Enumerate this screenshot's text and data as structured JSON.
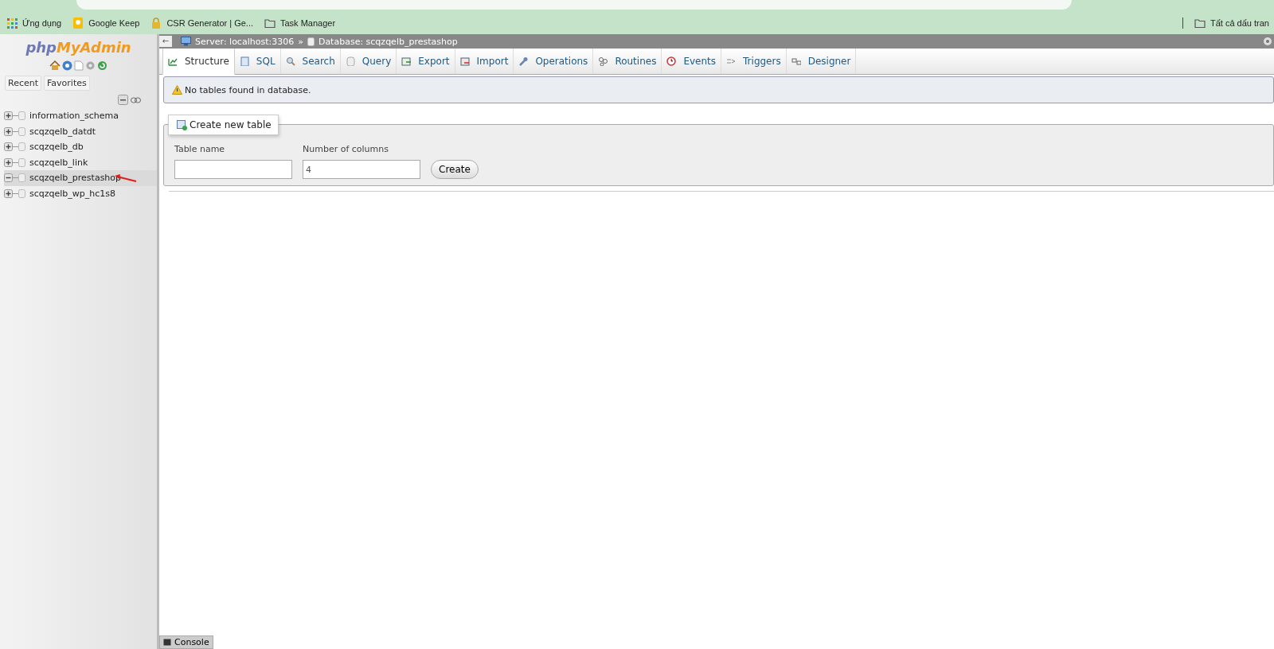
{
  "bookmarks_bar": {
    "items": [
      {
        "label": "Ứng dụng",
        "kind": "apps"
      },
      {
        "label": "Google Keep",
        "kind": "keep"
      },
      {
        "label": "CSR Generator | Ge...",
        "kind": "lock"
      },
      {
        "label": "Task Manager",
        "kind": "folder"
      }
    ],
    "right_item": {
      "label": "Tất cả dấu tran",
      "kind": "folder"
    }
  },
  "sidebar": {
    "logo": {
      "part_1": "php",
      "part_2": "MyAdmin"
    },
    "tabs": [
      {
        "label": "Recent"
      },
      {
        "label": "Favorites"
      }
    ],
    "databases": [
      {
        "name": "information_schema",
        "expanded": false,
        "selected": false
      },
      {
        "name": "scqzqelb_datdt",
        "expanded": false,
        "selected": false
      },
      {
        "name": "scqzqelb_db",
        "expanded": false,
        "selected": false
      },
      {
        "name": "scqzqelb_link",
        "expanded": false,
        "selected": false
      },
      {
        "name": "scqzqelb_prestashop",
        "expanded": true,
        "selected": true
      },
      {
        "name": "scqzqelb_wp_hc1s8",
        "expanded": false,
        "selected": false
      }
    ]
  },
  "breadcrumb": {
    "back": "←",
    "server": "Server: localhost:3306",
    "separator": "»",
    "database": "Database: scqzqelb_prestashop"
  },
  "tabs": [
    {
      "label": "Structure",
      "selected": true
    },
    {
      "label": "SQL",
      "selected": false
    },
    {
      "label": "Search",
      "selected": false
    },
    {
      "label": "Query",
      "selected": false
    },
    {
      "label": "Export",
      "selected": false
    },
    {
      "label": "Import",
      "selected": false
    },
    {
      "label": "Operations",
      "selected": false
    },
    {
      "label": "Routines",
      "selected": false
    },
    {
      "label": "Events",
      "selected": false
    },
    {
      "label": "Triggers",
      "selected": false
    },
    {
      "label": "Designer",
      "selected": false
    }
  ],
  "notice": "No tables found in database.",
  "create_table": {
    "legend": "Create new table",
    "table_name_label": "Table name",
    "columns_label": "Number of columns",
    "columns_value": "4",
    "button": "Create"
  },
  "console": {
    "label": "Console"
  }
}
